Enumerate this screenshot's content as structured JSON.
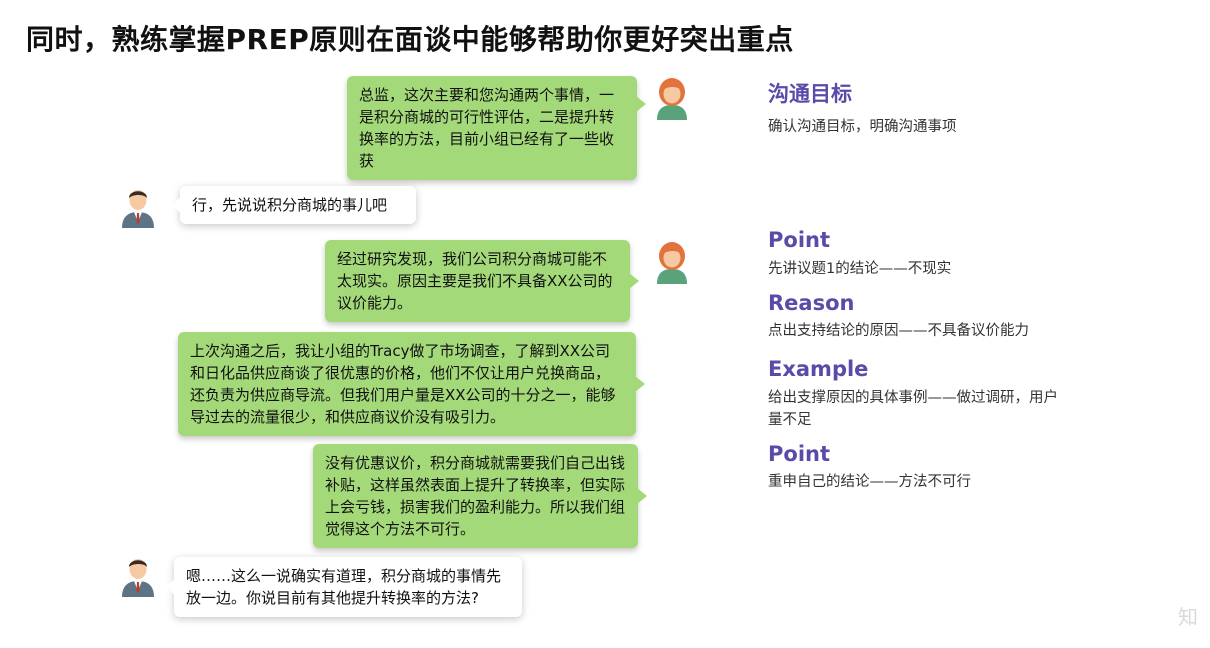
{
  "title": "同时，熟练掌握PREP原则在面谈中能够帮助你更好突出重点",
  "messages": [
    {
      "from": "female",
      "text": "总监，这次主要和您沟通两个事情，一是积分商城的可行性评估，二是提升转换率的方法，目前小组已经有了一些收获"
    },
    {
      "from": "male",
      "text": "行，先说说积分商城的事儿吧"
    },
    {
      "from": "female",
      "text": "经过研究发现，我们公司积分商城可能不太现实。原因主要是我们不具备XX公司的议价能力。"
    },
    {
      "from": "female",
      "text": "上次沟通之后，我让小组的Tracy做了市场调查，了解到XX公司和日化品供应商谈了很优惠的价格，他们不仅让用户兑换商品，还负责为供应商导流。但我们用户量是XX公司的十分之一，能够导过去的流量很少，和供应商议价没有吸引力。"
    },
    {
      "from": "female",
      "text": "没有优惠议价，积分商城就需要我们自己出钱补贴，这样虽然表面上提升了转换率，但实际上会亏钱，损害我们的盈利能力。所以我们组觉得这个方法不可行。"
    },
    {
      "from": "male",
      "text": "嗯……这么一说确实有道理，积分商城的事情先放一边。你说目前有其他提升转换率的方法?"
    }
  ],
  "labels": [
    {
      "heading": "沟通目标",
      "desc": "确认沟通目标，明确沟通事项"
    },
    {
      "heading": "Point",
      "desc": "先讲议题1的结论——不现实"
    },
    {
      "heading": "Reason",
      "desc": "点出支持结论的原因——不具备议价能力"
    },
    {
      "heading": "Example",
      "desc": "给出支撑原因的具体事例——做过调研，用户量不足"
    },
    {
      "heading": "Point",
      "desc": "重申自己的结论——方法不可行"
    }
  ],
  "watermark": "知",
  "colors": {
    "bubble_green": "#a4d97a",
    "heading_purple": "#5b4aa8",
    "female_hair": "#e2733d",
    "male_suit": "#5d7386"
  }
}
